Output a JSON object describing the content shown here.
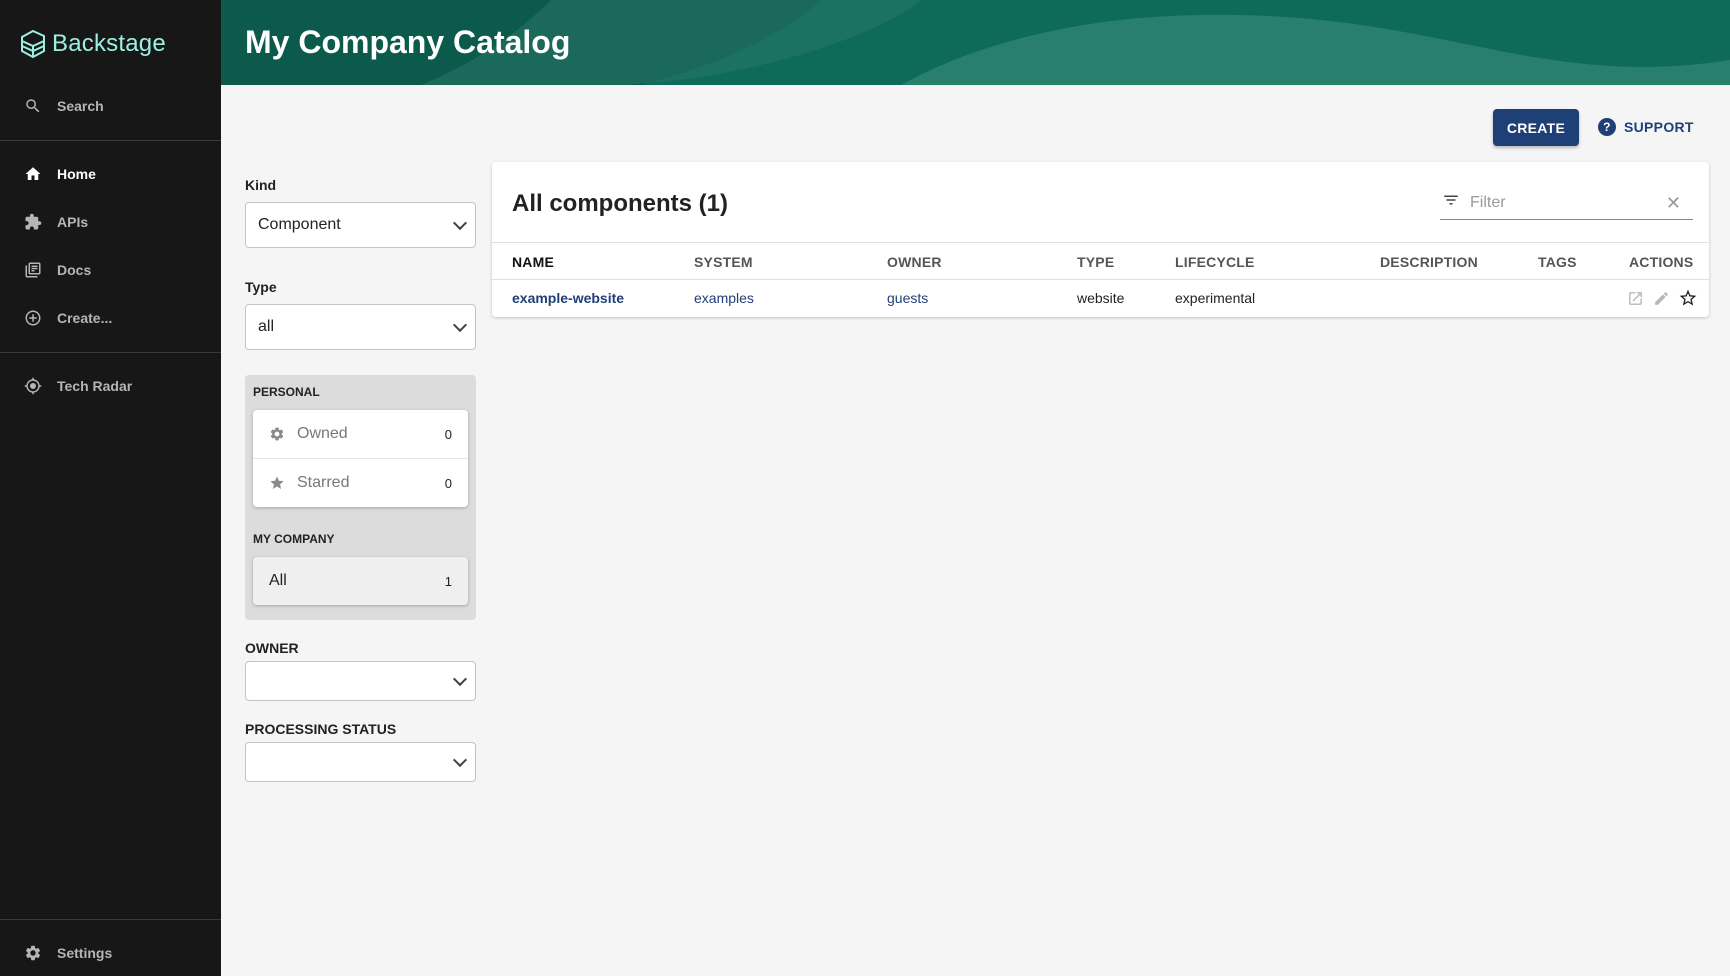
{
  "app": {
    "brand": "Backstage"
  },
  "sidebar": {
    "search_label": "Search",
    "items": [
      {
        "label": "Home",
        "icon": "home-icon",
        "active": true
      },
      {
        "label": "APIs",
        "icon": "puzzle-icon"
      },
      {
        "label": "Docs",
        "icon": "docs-icon"
      },
      {
        "label": "Create...",
        "icon": "add-circle-icon"
      }
    ],
    "tech_radar_label": "Tech Radar",
    "settings_label": "Settings"
  },
  "header": {
    "title": "My Company Catalog"
  },
  "actions": {
    "create_label": "CREATE",
    "support_label": "SUPPORT"
  },
  "filters": {
    "kind_label": "Kind",
    "kind_value": "Component",
    "type_label": "Type",
    "type_value": "all",
    "personal_title": "PERSONAL",
    "owned_label": "Owned",
    "owned_count": "0",
    "starred_label": "Starred",
    "starred_count": "0",
    "company_title": "MY COMPANY",
    "all_label": "All",
    "all_count": "1",
    "owner_label": "OWNER",
    "processing_label": "PROCESSING STATUS"
  },
  "table": {
    "title": "All components (1)",
    "filter_placeholder": "Filter",
    "columns": [
      "NAME",
      "SYSTEM",
      "OWNER",
      "TYPE",
      "LIFECYCLE",
      "DESCRIPTION",
      "TAGS",
      "ACTIONS"
    ],
    "rows": [
      {
        "name": "example-website",
        "system": "examples",
        "owner": "guests",
        "type": "website",
        "lifecycle": "experimental",
        "description": "",
        "tags": ""
      }
    ]
  },
  "colors": {
    "sidebar_bg": "#171717",
    "header_bg": "#0b5a4b",
    "accent": "#1f3f77",
    "logo": "#9bf0e1"
  }
}
